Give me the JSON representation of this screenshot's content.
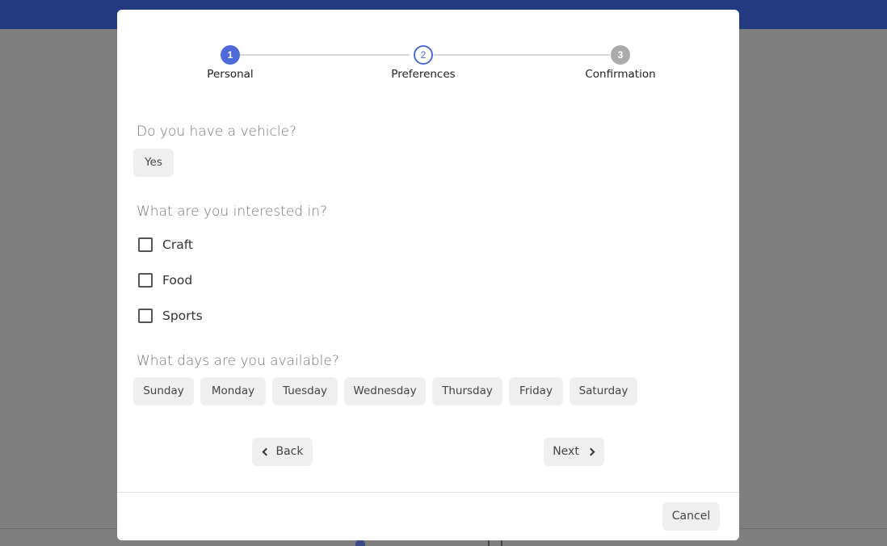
{
  "stepper": {
    "steps": [
      {
        "number": "1",
        "label": "Personal",
        "state": "completed"
      },
      {
        "number": "2",
        "label": "Preferences",
        "state": "current"
      },
      {
        "number": "3",
        "label": "Confirmation",
        "state": "pending"
      }
    ]
  },
  "vehicle": {
    "question": "Do you have a vehicle?",
    "option": "Yes"
  },
  "interests": {
    "question": "What are you interested in?",
    "options": [
      {
        "label": "Craft",
        "checked": false
      },
      {
        "label": "Food",
        "checked": false
      },
      {
        "label": "Sports",
        "checked": false
      }
    ]
  },
  "days": {
    "question": "What days are you available?",
    "options": [
      "Sunday",
      "Monday",
      "Tuesday",
      "Wednesday",
      "Thursday",
      "Friday",
      "Saturday"
    ]
  },
  "navigation": {
    "back_label": "Back",
    "next_label": "Next"
  },
  "footer": {
    "cancel_label": "Cancel"
  },
  "colors": {
    "accent": "#4e6ad8",
    "topbar": "#243a80",
    "overlay": "#7f7f7f",
    "chip_bg": "#efefef"
  }
}
